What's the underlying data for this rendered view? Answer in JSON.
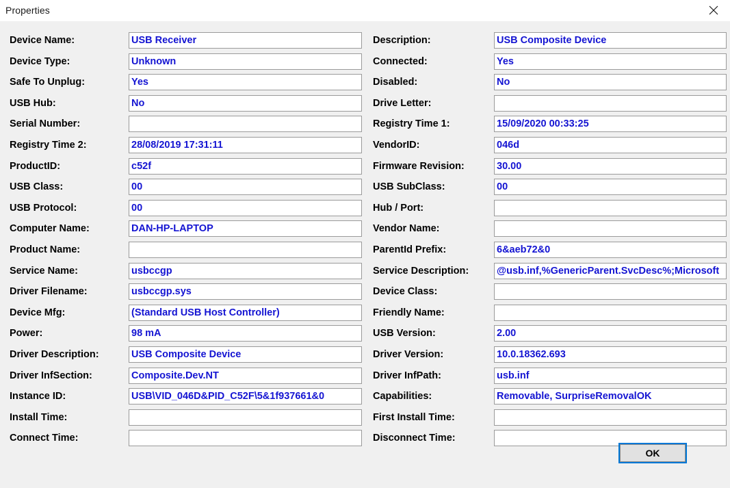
{
  "window": {
    "title": "Properties",
    "close_icon": "close-icon",
    "background_color": "#f0f0f0",
    "value_color": "#1414d2",
    "label_color": "#000000",
    "focus_color": "#0078d7"
  },
  "buttons": {
    "ok_label": "OK"
  },
  "rows": [
    {
      "left": {
        "label": "Device Name:",
        "value": "USB Receiver"
      },
      "right": {
        "label": "Description:",
        "value": "USB Composite Device"
      }
    },
    {
      "left": {
        "label": "Device Type:",
        "value": "Unknown"
      },
      "right": {
        "label": "Connected:",
        "value": "Yes"
      }
    },
    {
      "left": {
        "label": "Safe To Unplug:",
        "value": "Yes"
      },
      "right": {
        "label": "Disabled:",
        "value": "No"
      }
    },
    {
      "left": {
        "label": "USB Hub:",
        "value": "No"
      },
      "right": {
        "label": "Drive Letter:",
        "value": ""
      }
    },
    {
      "left": {
        "label": "Serial Number:",
        "value": ""
      },
      "right": {
        "label": "Registry Time 1:",
        "value": "15/09/2020 00:33:25"
      }
    },
    {
      "left": {
        "label": "Registry Time 2:",
        "value": "28/08/2019 17:31:11"
      },
      "right": {
        "label": "VendorID:",
        "value": "046d"
      }
    },
    {
      "left": {
        "label": "ProductID:",
        "value": "c52f"
      },
      "right": {
        "label": "Firmware Revision:",
        "value": "30.00"
      }
    },
    {
      "left": {
        "label": "USB Class:",
        "value": "00"
      },
      "right": {
        "label": "USB SubClass:",
        "value": "00"
      }
    },
    {
      "left": {
        "label": "USB Protocol:",
        "value": "00"
      },
      "right": {
        "label": "Hub / Port:",
        "value": ""
      }
    },
    {
      "left": {
        "label": "Computer Name:",
        "value": "DAN-HP-LAPTOP"
      },
      "right": {
        "label": "Vendor Name:",
        "value": ""
      }
    },
    {
      "left": {
        "label": "Product Name:",
        "value": ""
      },
      "right": {
        "label": "ParentId Prefix:",
        "value": "6&aeb72&0"
      }
    },
    {
      "left": {
        "label": "Service Name:",
        "value": "usbccgp"
      },
      "right": {
        "label": "Service Description:",
        "value": "@usb.inf,%GenericParent.SvcDesc%;Microsoft"
      }
    },
    {
      "left": {
        "label": "Driver Filename:",
        "value": "usbccgp.sys"
      },
      "right": {
        "label": "Device Class:",
        "value": ""
      }
    },
    {
      "left": {
        "label": "Device Mfg:",
        "value": "(Standard USB Host Controller)"
      },
      "right": {
        "label": "Friendly Name:",
        "value": ""
      }
    },
    {
      "left": {
        "label": "Power:",
        "value": "98 mA"
      },
      "right": {
        "label": "USB Version:",
        "value": "2.00"
      }
    },
    {
      "left": {
        "label": "Driver Description:",
        "value": "USB Composite Device"
      },
      "right": {
        "label": "Driver Version:",
        "value": "10.0.18362.693"
      }
    },
    {
      "left": {
        "label": "Driver InfSection:",
        "value": "Composite.Dev.NT"
      },
      "right": {
        "label": "Driver InfPath:",
        "value": "usb.inf"
      }
    },
    {
      "left": {
        "label": "Instance ID:",
        "value": "USB\\VID_046D&PID_C52F\\5&1f937661&0"
      },
      "right": {
        "label": "Capabilities:",
        "value": "Removable, SurpriseRemovalOK"
      }
    },
    {
      "left": {
        "label": "Install Time:",
        "value": ""
      },
      "right": {
        "label": "First Install Time:",
        "value": ""
      }
    },
    {
      "left": {
        "label": "Connect Time:",
        "value": ""
      },
      "right": {
        "label": "Disconnect Time:",
        "value": ""
      }
    }
  ]
}
